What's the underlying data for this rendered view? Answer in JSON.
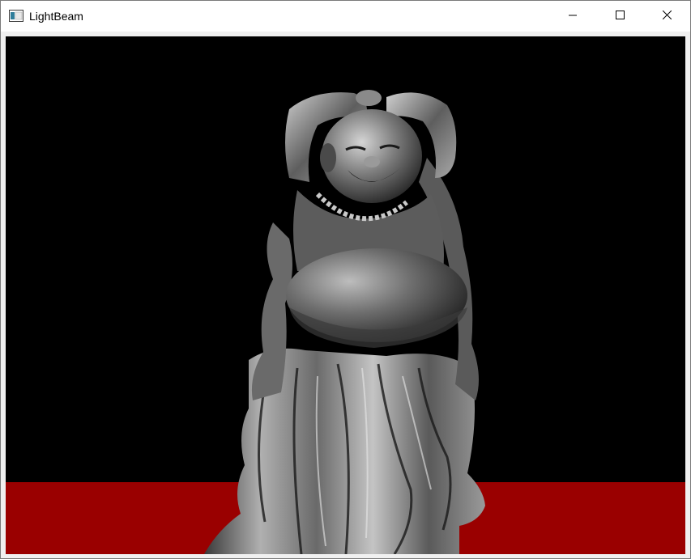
{
  "window": {
    "title": "LightBeam",
    "icons": {
      "app": "app-window-icon",
      "minimize": "minimize-icon",
      "maximize": "maximize-icon",
      "close": "close-icon"
    }
  },
  "scene": {
    "subject": "buddha-statue-render",
    "background_color": "#000000",
    "floor_color": "#9a0000",
    "statue_tone": "grayscale"
  }
}
